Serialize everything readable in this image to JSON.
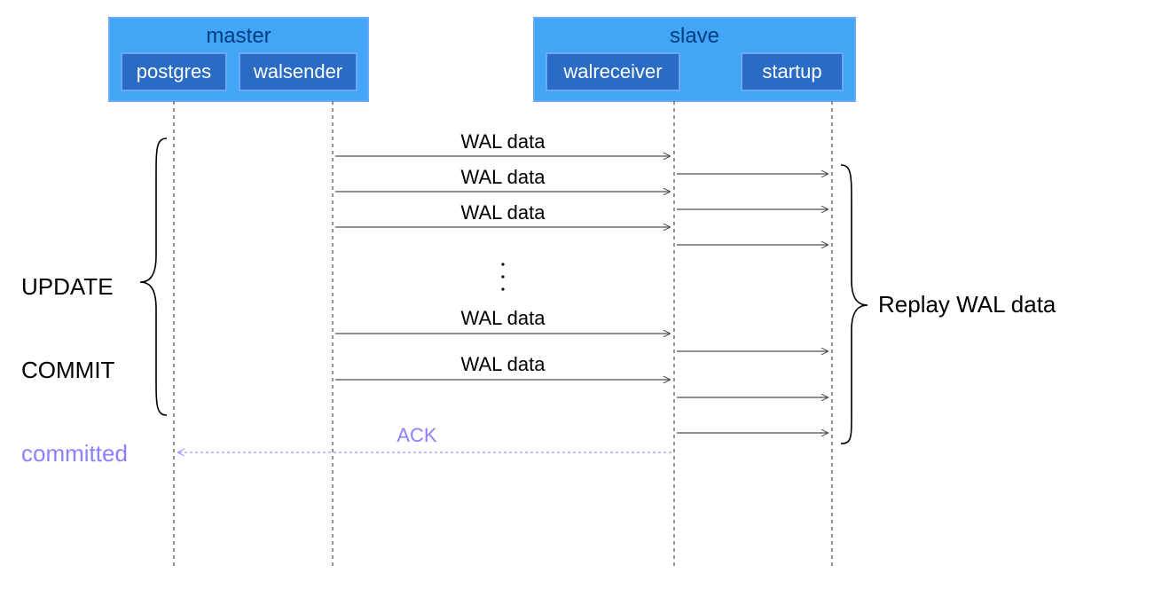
{
  "master": {
    "title": "master",
    "procs": {
      "postgres": "postgres",
      "walsender": "walsender"
    }
  },
  "slave": {
    "title": "slave",
    "procs": {
      "walreceiver": "walreceiver",
      "startup": "startup"
    }
  },
  "labels": {
    "update": "UPDATE",
    "commit": "COMMIT",
    "committed": "committed",
    "replay": "Replay WAL data",
    "ack": "ACK",
    "wal": "WAL data"
  }
}
